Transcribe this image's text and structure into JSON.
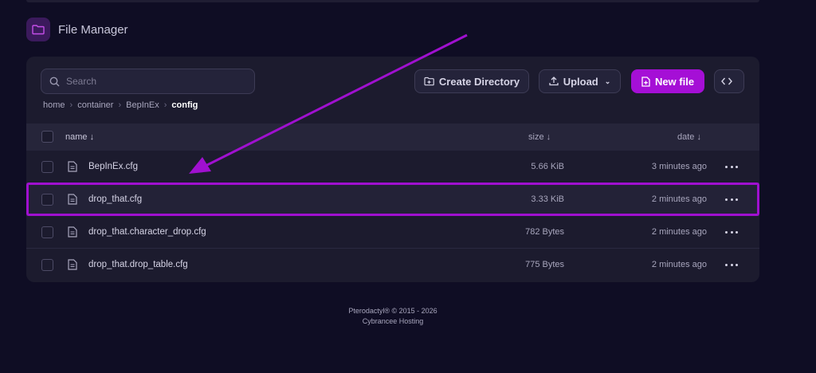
{
  "header": {
    "title": "File Manager"
  },
  "search": {
    "placeholder": "Search"
  },
  "toolbar": {
    "create_directory": "Create Directory",
    "upload": "Upload",
    "new_file": "New file"
  },
  "breadcrumb": [
    "home",
    "container",
    "BepInEx",
    "config"
  ],
  "table": {
    "columns": {
      "name": "name ↓",
      "size": "size ↓",
      "date": "date ↓"
    },
    "rows": [
      {
        "name": "BepInEx.cfg",
        "size": "5.66 KiB",
        "date": "3 minutes ago"
      },
      {
        "name": "drop_that.cfg",
        "size": "3.33 KiB",
        "date": "2 minutes ago"
      },
      {
        "name": "drop_that.character_drop.cfg",
        "size": "782 Bytes",
        "date": "2 minutes ago"
      },
      {
        "name": "drop_that.drop_table.cfg",
        "size": "775 Bytes",
        "date": "2 minutes ago"
      }
    ]
  },
  "footer": {
    "line1": "Pterodactyl® © 2015 - 2026",
    "line2": "Cybrancee Hosting"
  },
  "colors": {
    "accent": "#a50fd6",
    "background": "#0f0d24",
    "panel": "#1c1b2e"
  }
}
